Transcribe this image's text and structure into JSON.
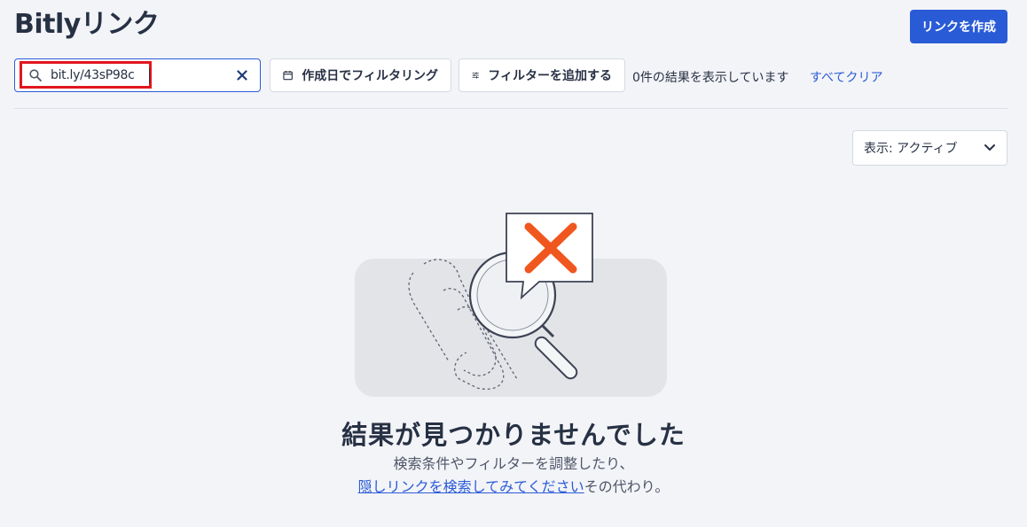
{
  "header": {
    "title": "Bitlyリンク",
    "create_button": "リンクを作成"
  },
  "search": {
    "value": "bit.ly/43sP98c",
    "icon": "search-icon",
    "clear_icon": "close-icon"
  },
  "filters": {
    "date_filter": "作成日でフィルタリング",
    "add_filter": "フィルターを追加する",
    "results_count": "0件の結果を表示しています",
    "clear_all": "すべてクリア"
  },
  "view_select": {
    "label": "表示: アクティブ"
  },
  "empty_state": {
    "title": "結果が見つかりませんでした",
    "description": "検索条件やフィルターを調整したり、",
    "hidden_link": "隠しリンクを検索してみてください",
    "suffix": "その代わり。"
  },
  "colors": {
    "accent": "#2a5bd7",
    "highlight": "#e0161e",
    "error_x": "#f0571f",
    "background": "#f3f4f8"
  }
}
